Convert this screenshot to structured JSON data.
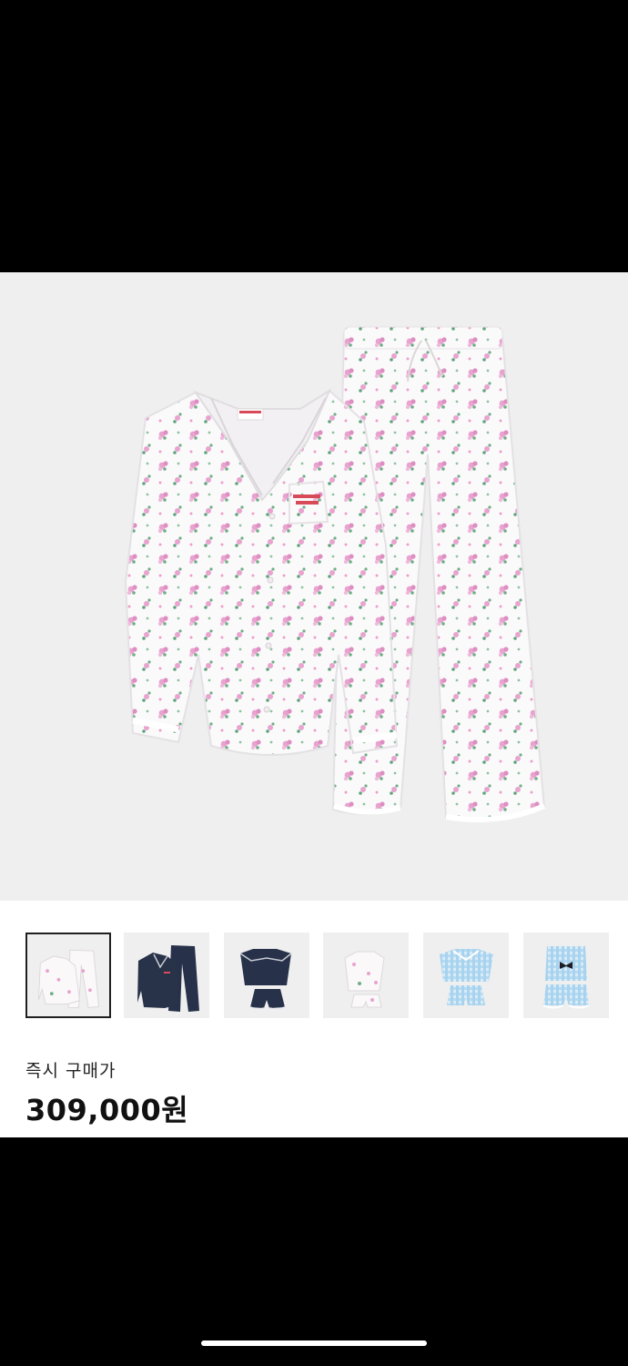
{
  "product": {
    "main_image": "floral-pajama-set",
    "thumbnails": [
      {
        "name": "floral-pajama-set",
        "selected": true
      },
      {
        "name": "navy-pajama-set",
        "selected": false
      },
      {
        "name": "navy-ruffle-shorts-set",
        "selected": false
      },
      {
        "name": "floral-dress-set",
        "selected": false
      },
      {
        "name": "blue-gingham-puff-set",
        "selected": false
      },
      {
        "name": "blue-gingham-bow-set",
        "selected": false
      }
    ]
  },
  "purchase": {
    "label": "즉시 구매가",
    "price": "309,000원"
  },
  "colors": {
    "background": "#000000",
    "image_bg": "#efefef",
    "panel": "#ffffff",
    "floral_pink": "#e8a3cf",
    "leaf_green": "#6fae86",
    "navy": "#27324a",
    "gingham_blue": "#a9d3ee"
  }
}
